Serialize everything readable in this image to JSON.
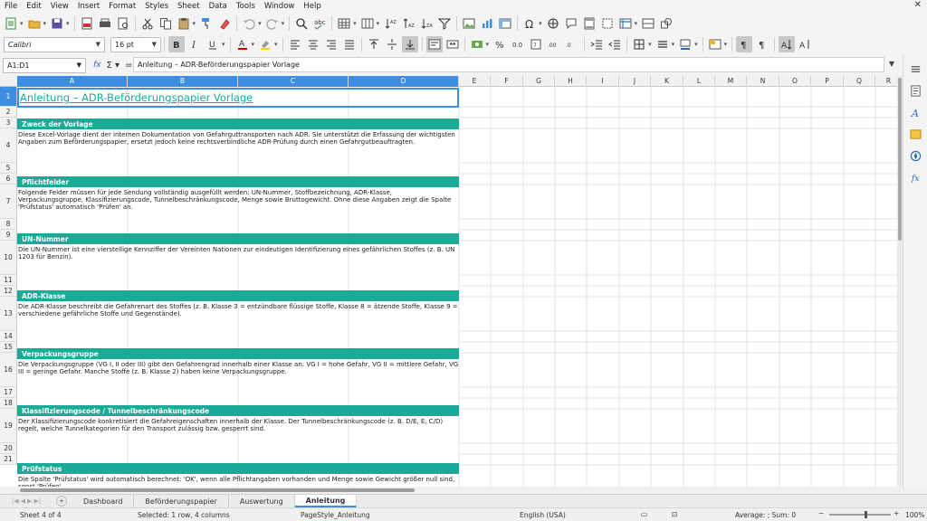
{
  "menu": [
    "File",
    "Edit",
    "View",
    "Insert",
    "Format",
    "Styles",
    "Sheet",
    "Data",
    "Tools",
    "Window",
    "Help"
  ],
  "font": {
    "name": "Calibri",
    "size": "16 pt"
  },
  "formula_bar": {
    "cell_ref": "A1:D1",
    "content": "Anleitung – ADR-Beförderungspapier Vorlage"
  },
  "columns": [
    "A",
    "B",
    "C",
    "D",
    "E",
    "F",
    "G",
    "H",
    "I",
    "J",
    "K",
    "L",
    "M",
    "N",
    "O",
    "P",
    "Q",
    "R"
  ],
  "rows": [
    "1",
    "2",
    "3",
    "4",
    "5",
    "6",
    "7",
    "8",
    "9",
    "10",
    "11",
    "12",
    "13",
    "14",
    "15",
    "16",
    "17",
    "18",
    "19",
    "20",
    "21"
  ],
  "sheet": {
    "title": "Anleitung – ADR-Beförderungspapier Vorlage",
    "sections": [
      {
        "heading": "Zweck der Vorlage",
        "text": "Diese Excel-Vorlage dient der internen Dokumentation von Gefahrguttransporten nach ADR. Sie unterstützt die Erfassung der wichtigsten Angaben zum Beförderungspapier, ersetzt jedoch keine rechtsverbindliche ADR-Prüfung durch einen Gefahrgutbeauftragten."
      },
      {
        "heading": "Pflichtfelder",
        "text": "Folgende Felder müssen für jede Sendung vollständig ausgefüllt werden: UN-Nummer, Stoffbezeichnung, ADR-Klasse, Verpackungsgruppe, Klassifizierungscode, Tunnelbeschränkungscode, Menge sowie Bruttogewicht. Ohne diese Angaben zeigt die Spalte 'Prüfstatus' automatisch 'Prüfen' an."
      },
      {
        "heading": "UN-Nummer",
        "text": "Die UN-Nummer ist eine vierstellige Kennziffer der Vereinten Nationen zur eindeutigen Identifizierung eines gefährlichen Stoffes (z. B. UN 1203 für Benzin)."
      },
      {
        "heading": "ADR-Klasse",
        "text": "Die ADR-Klasse beschreibt die Gefahrenart des Stoffes (z. B. Klasse 3 = entzündbare flüssige Stoffe, Klasse 8 = ätzende Stoffe, Klasse 9 = verschiedene gefährliche Stoffe und Gegenstände)."
      },
      {
        "heading": "Verpackungsgruppe",
        "text": "Die Verpackungsgruppe (VG I, II oder III) gibt den Gefahrengrad innerhalb einer Klasse an: VG I = hohe Gefahr, VG II = mittlere Gefahr, VG III = geringe Gefahr. Manche Stoffe (z. B. Klasse 2) haben keine Verpackungsgruppe."
      },
      {
        "heading": "Klassifizierungscode / Tunnelbeschränkungscode",
        "text": "Der Klassifizierungscode konkretisiert die Gefahreigenschaften innerhalb der Klasse. Der Tunnelbeschränkungscode (z. B. D/E, E, C/D) regelt, welche Tunnelkategorien für den Transport zulässig bzw. gesperrt sind."
      },
      {
        "heading": "Prüfstatus",
        "text": "Die Spalte 'Prüfstatus' wird automatisch berechnet: 'OK', wenn alle Pflichtangaben vorhanden und Menge sowie Gewicht größer null sind, sonst 'Prüfen'."
      }
    ]
  },
  "tabs": [
    "Dashboard",
    "Beförderungspapier",
    "Auswertung",
    "Anleitung"
  ],
  "active_tab": "Anleitung",
  "status": {
    "sheet": "Sheet 4 of 4",
    "selection": "Selected: 1 row, 4 columns",
    "page_style": "PageStyle_Anleitung",
    "language": "English (USA)",
    "summary": "Average: ; Sum: 0",
    "zoom": "100%"
  },
  "colors": {
    "accent": "#1aab98",
    "selection": "#3d8ee0"
  }
}
